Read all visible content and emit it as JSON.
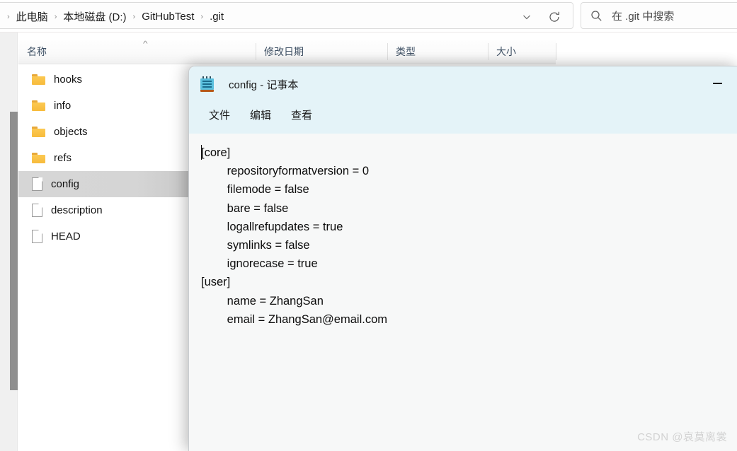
{
  "explorer": {
    "address_bar": {
      "breadcrumbs": [
        {
          "label": "此电脑"
        },
        {
          "label": "本地磁盘 (D:)"
        },
        {
          "label": "GitHubTest"
        },
        {
          "label": ".git"
        }
      ],
      "separator": "›",
      "chevron_icon": "chevron-down-icon",
      "refresh_icon": "refresh-icon"
    },
    "search": {
      "placeholder": "在 .git 中搜索",
      "icon": "search-icon"
    },
    "columns": [
      {
        "label": "名称",
        "sort": "asc"
      },
      {
        "label": "修改日期"
      },
      {
        "label": "类型"
      },
      {
        "label": "大小"
      }
    ],
    "sort_caret": "^",
    "files": [
      {
        "name": "hooks",
        "type": "folder",
        "selected": false
      },
      {
        "name": "info",
        "type": "folder",
        "selected": false
      },
      {
        "name": "objects",
        "type": "folder",
        "selected": false
      },
      {
        "name": "refs",
        "type": "folder",
        "selected": false
      },
      {
        "name": "config",
        "type": "file",
        "selected": true
      },
      {
        "name": "description",
        "type": "file",
        "selected": false
      },
      {
        "name": "HEAD",
        "type": "file",
        "selected": false
      }
    ]
  },
  "notepad": {
    "title": "config - 记事本",
    "icon": "notepad-icon",
    "minimize_label": "—",
    "menu": [
      {
        "label": "文件"
      },
      {
        "label": "编辑"
      },
      {
        "label": "查看"
      }
    ],
    "content": "[core]\n        repositoryformatversion = 0\n        filemode = false\n        bare = false\n        logallrefupdates = true\n        symlinks = false\n        ignorecase = true\n[user]\n        name = ZhangSan\n        email = ZhangSan@email.com"
  },
  "watermark": "CSDN @哀莫离裳",
  "colors": {
    "notepad_titlebar": "#e4f3f8",
    "folder_yellow": "#f7bb3c",
    "selection_gray": "#d6d6d6",
    "column_header_text": "#3d4f63"
  }
}
